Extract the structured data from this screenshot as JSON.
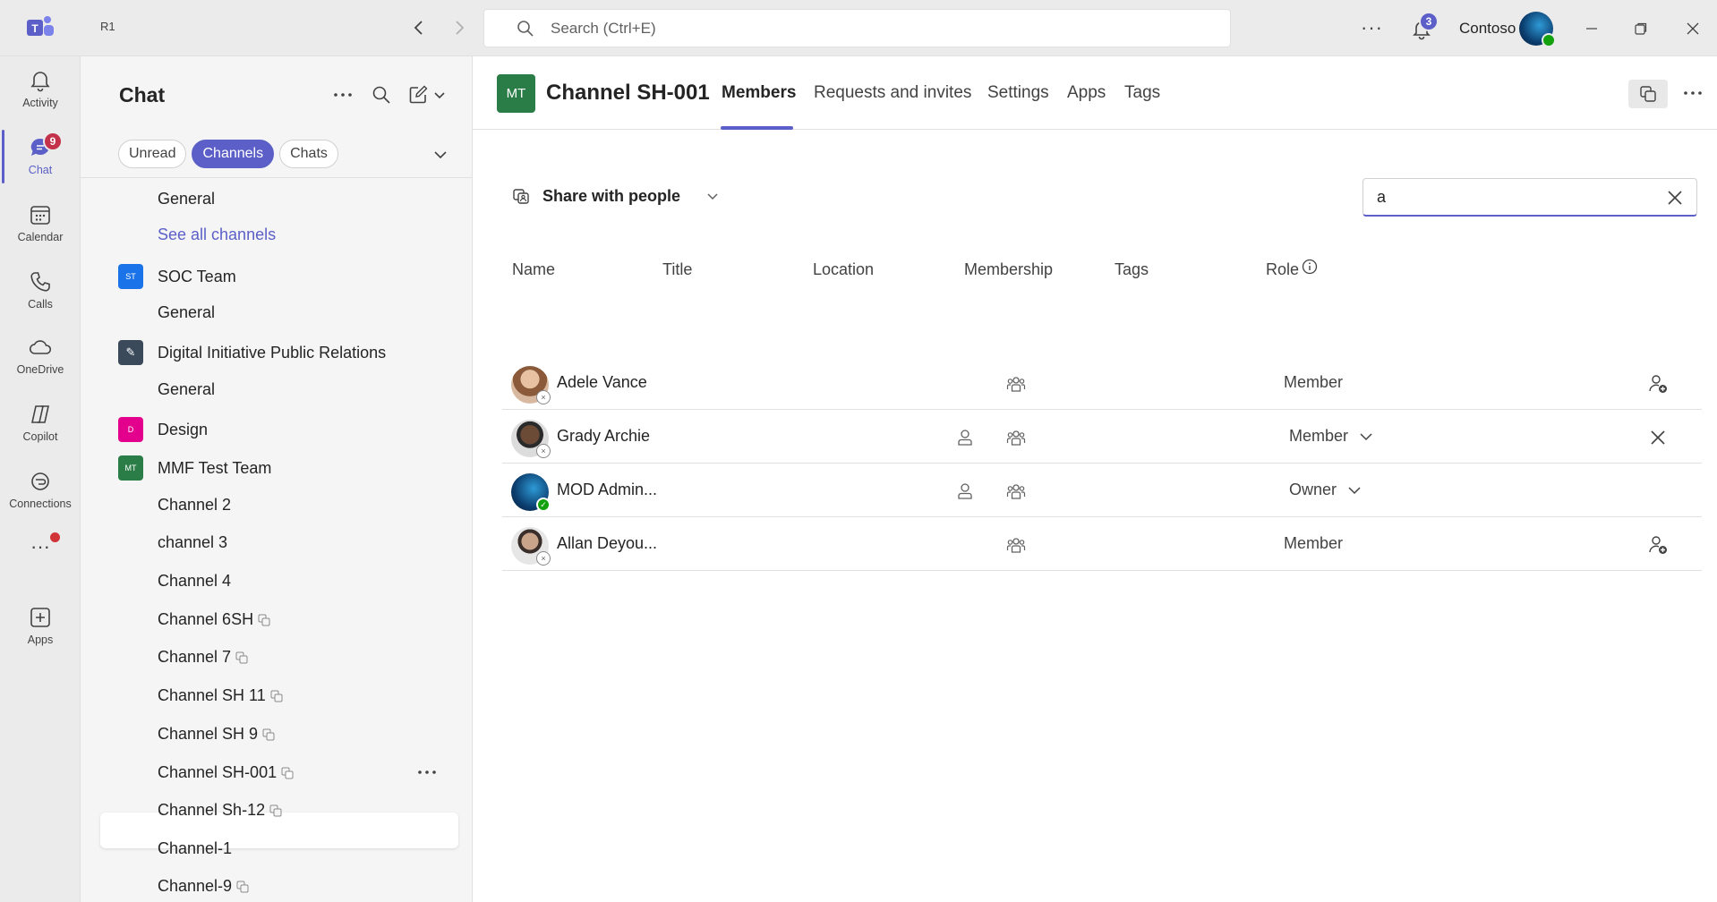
{
  "titlebar": {
    "window_label": "R1",
    "search_placeholder": "Search (Ctrl+E)",
    "notifications_count": "3",
    "org_name": "Contoso",
    "more_label": "···"
  },
  "rail": {
    "items": [
      {
        "label": "Activity"
      },
      {
        "label": "Chat",
        "badge": "9"
      },
      {
        "label": "Calendar"
      },
      {
        "label": "Calls"
      },
      {
        "label": "OneDrive"
      },
      {
        "label": "Copilot"
      },
      {
        "label": "Connections"
      },
      {
        "label": "···"
      },
      {
        "label": "Apps"
      }
    ]
  },
  "chatpane": {
    "title": "Chat",
    "filters": [
      "Unread",
      "Channels",
      "Chats"
    ],
    "active_filter": "Channels",
    "items": [
      {
        "text": "General",
        "type": "channel"
      },
      {
        "text": "See all channels",
        "type": "link"
      },
      {
        "text": "SOC Team",
        "type": "team",
        "logo": "ST",
        "color": "#1a73e8"
      },
      {
        "text": "General",
        "type": "channel"
      },
      {
        "text": "Digital Initiative Public Relations",
        "type": "team",
        "logo": "✎",
        "color": "#3b4a5a"
      },
      {
        "text": "General",
        "type": "channel"
      },
      {
        "text": "Design",
        "type": "team",
        "logo": "D",
        "color": "#e3008c"
      },
      {
        "text": "MMF Test Team",
        "type": "team",
        "logo": "MT",
        "color": "#2a7d46"
      },
      {
        "text": "Channel 2",
        "type": "channel"
      },
      {
        "text": "channel 3",
        "type": "channel"
      },
      {
        "text": "Channel 4",
        "type": "channel"
      },
      {
        "text": "Channel 6SH",
        "type": "channel",
        "shared": true
      },
      {
        "text": "Channel 7",
        "type": "channel",
        "shared": true
      },
      {
        "text": "Channel SH 11",
        "type": "channel",
        "shared": true
      },
      {
        "text": "Channel SH 9",
        "type": "channel",
        "shared": true
      },
      {
        "text": "Channel SH-001",
        "type": "channel",
        "shared": true,
        "selected": true
      },
      {
        "text": "Channel Sh-12",
        "type": "channel",
        "shared": true
      },
      {
        "text": "Channel-1",
        "type": "channel"
      },
      {
        "text": "Channel-9",
        "type": "channel",
        "shared": true
      }
    ]
  },
  "main": {
    "logo": "MT",
    "logo_color": "#2a7d46",
    "title": "Channel SH-001",
    "tabs": [
      "Members",
      "Requests and invites",
      "Settings",
      "Apps",
      "Tags"
    ],
    "active_tab": "Members",
    "share_label": "Share with people",
    "filter_value": "a",
    "columns": [
      "Name",
      "Title",
      "Location",
      "Membership",
      "Tags",
      "Role"
    ],
    "members": [
      {
        "name": "Adele Vance",
        "role": "Member",
        "role_dropdown": false,
        "action": "add-person",
        "direct_member": false,
        "status": "offline",
        "avatar_color": "#b5734a"
      },
      {
        "name": "Grady Archie",
        "role": "Member",
        "role_dropdown": true,
        "action": "remove",
        "direct_member": true,
        "status": "offline",
        "avatar_color": "#6b4a36"
      },
      {
        "name": "MOD Admin...",
        "role": "Owner",
        "role_dropdown": true,
        "action": "",
        "direct_member": true,
        "status": "available",
        "avatar_color": "#0b3d6e"
      },
      {
        "name": "Allan Deyou...",
        "role": "Member",
        "role_dropdown": false,
        "action": "add-person",
        "direct_member": false,
        "status": "offline",
        "avatar_color": "#5a4a42"
      }
    ]
  },
  "colors": {
    "accent": "#5b5fc7",
    "badge_red": "#c4314b",
    "available_green": "#13a10e"
  }
}
